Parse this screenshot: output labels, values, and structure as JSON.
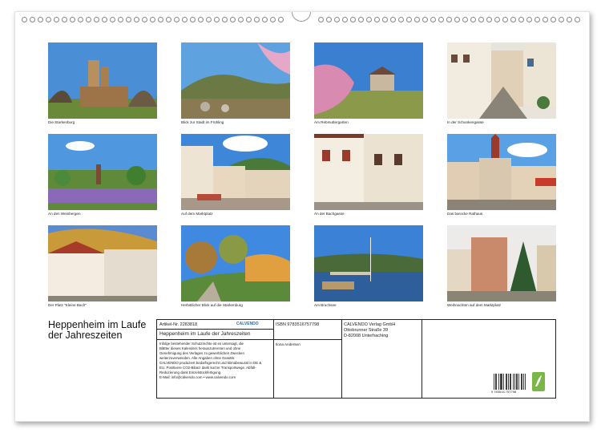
{
  "title": "Heppenheim im Laufe der Jahreszeiten",
  "captions": [
    "Die Starkenburg",
    "Blick zur Stadt im Frühling",
    "Am Rebmuttergarten",
    "In der Schunkengasse",
    "An den Weinbergen",
    "Auf dem Marktplatz",
    "An der Bachgasse",
    "Das barocke Rathaus",
    "Der Platz \"Kleine Bach\"",
    "Herbstlicher Blick auf die Starkenburg",
    "Am Bruchsee",
    "Weihnachten auf dem Marktplatz"
  ],
  "info": {
    "article": "Artikel-Nr. 2283818",
    "logo": "CALVENDO",
    "isbn": "ISBN 9783516757798",
    "publisher_name": "CALVENDO Verlag GmbH",
    "publisher_street": "Ottobrunner Straße 39",
    "publisher_city": "D-82008 Unterhaching",
    "product_title": "Heppenheim im Laufe der Jahreszeiten",
    "author": "Ilona Andersen",
    "legal_1": "Infolge bestehender Schutzrechte ist es untersagt, die",
    "legal_2": "Blätter dieses Kalenders herauszutrennen und ohne",
    "legal_3": "Genehmigung des Verlages zu gewerblichen Zwecken",
    "legal_4": "weiterzuverwenden. Alle Angaben ohne Gewähr.",
    "legal_5": "CALVENDO produziert bedarfsgerecht und klimabewusst in DE &",
    "legal_6": "EU. Positivere CO2-Bilanz dank kurzer Transportwege. Abfall-",
    "legal_7": "Reduzierung dank Einzelstückfertigung.",
    "legal_8": "E-Mail: info@calvendo.com • www.calvendo.com",
    "barcode_number": "9 783516 757798"
  }
}
